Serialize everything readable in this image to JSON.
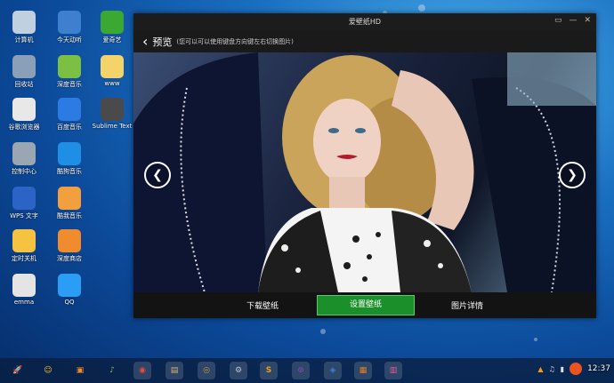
{
  "window": {
    "title": "爱壁纸HD",
    "controls": [
      "▭",
      "—",
      "✕"
    ],
    "page_title": "预览",
    "hint": "(您可以可以使用键盘方向键左右切换图片)",
    "prev_symbol": "❮",
    "next_symbol": "❯",
    "download_label": "下载壁纸",
    "set_label": "设置壁纸",
    "details_label": "图片详情"
  },
  "desktop_icons": [
    {
      "label": "计算机",
      "icon": "computer-icon",
      "color": "#c0d0e0"
    },
    {
      "label": "今天动听",
      "icon": "music-app-icon",
      "color": "#3e7fcf"
    },
    {
      "label": "爱奇艺",
      "icon": "iqiyi-icon",
      "color": "#3aa832"
    },
    {
      "label": "回收站",
      "icon": "trash-icon",
      "color": "#8aa0b8"
    },
    {
      "label": "深度音乐",
      "icon": "deepin-music-icon",
      "color": "#7bc043"
    },
    {
      "label": "www",
      "icon": "folder-icon",
      "color": "#f3d36a"
    },
    {
      "label": "谷歌浏览器",
      "icon": "chrome-icon",
      "color": "#e8e8e8"
    },
    {
      "label": "百度音乐",
      "icon": "baidu-music-icon",
      "color": "#2c7be5"
    },
    {
      "label": "Sublime Text",
      "icon": "sublime-icon",
      "color": "#4a4a4a"
    },
    {
      "label": "控制中心",
      "icon": "settings-icon",
      "color": "#9aa6b2"
    },
    {
      "label": "酷狗音乐",
      "icon": "kugou-icon",
      "color": "#1f8fe6"
    },
    {
      "label": "WPS 文字",
      "icon": "wps-icon",
      "color": "#2b63c7"
    },
    {
      "label": "酷我音乐",
      "icon": "kuwo-icon",
      "color": "#f2a03d"
    },
    {
      "label": "定时关机",
      "icon": "shutdown-timer-icon",
      "color": "#f5c242"
    },
    {
      "label": "深度商店",
      "icon": "store-icon",
      "color": "#f08c2e"
    },
    {
      "label": "emma",
      "icon": "emma-icon",
      "color": "#e4e4e4"
    },
    {
      "label": "QQ",
      "icon": "qq-icon",
      "color": "#2a9df4"
    }
  ],
  "taskbar": {
    "items": [
      {
        "name": "launcher-icon",
        "glyph": "🚀",
        "color": "#c0392b"
      },
      {
        "name": "smiley-app-icon",
        "glyph": "☺",
        "color": "#f5c242"
      },
      {
        "name": "store-task-icon",
        "glyph": "▣",
        "color": "#f08c2e"
      },
      {
        "name": "music-task-icon",
        "glyph": "♪",
        "color": "#7bc043"
      },
      {
        "name": "chrome-task-icon",
        "glyph": "◉",
        "color": "#e74c3c"
      },
      {
        "name": "files-task-icon",
        "glyph": "▤",
        "color": "#d7b46a"
      },
      {
        "name": "game-task-icon",
        "glyph": "◎",
        "color": "#c49a3a"
      },
      {
        "name": "settings-task-icon",
        "glyph": "⚙",
        "color": "#c0c6cc"
      },
      {
        "name": "sublime-task-icon",
        "glyph": "S",
        "color": "#f39c12"
      },
      {
        "name": "media-task-icon",
        "glyph": "⊙",
        "color": "#8e44ad"
      },
      {
        "name": "app-task-icon",
        "glyph": "◈",
        "color": "#3e7fcf"
      },
      {
        "name": "wallpaper-task-icon",
        "glyph": "▦",
        "color": "#e67e22"
      },
      {
        "name": "pictures-task-icon",
        "glyph": "▥",
        "color": "#e85a8a"
      }
    ],
    "clock": "12:37"
  }
}
